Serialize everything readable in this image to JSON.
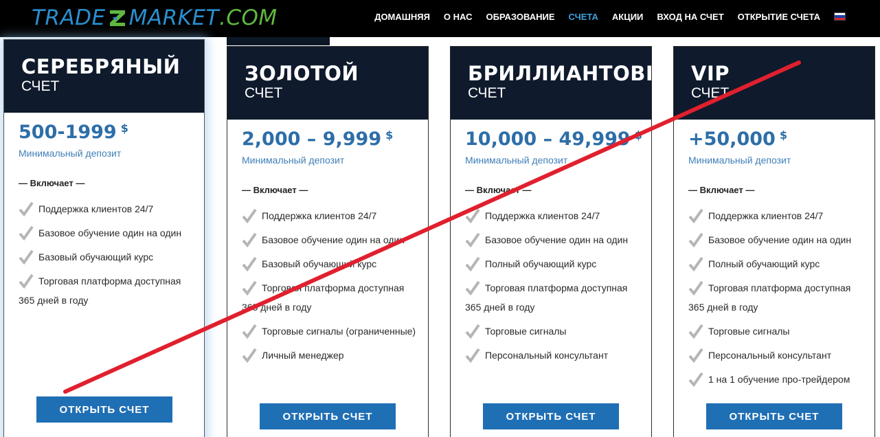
{
  "header": {
    "logo": {
      "part1": "TRADE",
      "part2": "MARKET",
      "part3": ".COM"
    },
    "nav": [
      {
        "label": "ДОМАШНЯЯ",
        "active": false
      },
      {
        "label": "О НАС",
        "active": false
      },
      {
        "label": "ОБРАЗОВАНИЕ",
        "active": false
      },
      {
        "label": "СЧЕТА",
        "active": true
      },
      {
        "label": "АКЦИИ",
        "active": false
      },
      {
        "label": "ВХОД НА СЧЕТ",
        "active": false
      },
      {
        "label": "ОТКРЫТИЕ СЧЕТА",
        "active": false
      }
    ],
    "language_flag": "russia-flag-icon"
  },
  "colors": {
    "header_bg": "#000000",
    "card_head_bg": "#0f1a2c",
    "price": "#2d6ea8",
    "button": "#1f6fb5",
    "active_nav": "#3fa0dc",
    "strike_line": "#e0202e"
  },
  "cards": [
    {
      "title": "СЕРЕБРЯНЫЙ",
      "subtitle": "СЧЕТ",
      "price": "500-1999",
      "currency": "$",
      "min_deposit_label": "Минимальный депозит",
      "includes_label": "— Включает —",
      "features": [
        "Поддержка клиентов 24/7",
        "Базовое обучение один на один",
        "Базовый обучающий курс",
        "Торговая платформа доступная",
        "365 дней в году"
      ],
      "button_label": "ОТКРЫТЬ СЧЕТ"
    },
    {
      "title": "ЗОЛОТОЙ",
      "subtitle": "СЧЕТ",
      "price": "2,000 – 9,999",
      "currency": "$",
      "min_deposit_label": "Минимальный депозит",
      "includes_label": "— Включает —",
      "features": [
        "Поддержка клиентов 24/7",
        "Базовое обучение один на один",
        "Базовый обучающий курс",
        "Торговая платформа доступная",
        "365 дней в году",
        "Торговые сигналы (ограниченные)",
        "Личный менеджер"
      ],
      "button_label": "ОТКРЫТЬ СЧЕТ"
    },
    {
      "title": "БРИЛЛИАНТОВЫЙ",
      "subtitle": "СЧЕТ",
      "price": "10,000 – 49,999",
      "currency": "$",
      "min_deposit_label": "Минимальный депозит",
      "includes_label": "— Включает —",
      "features": [
        "Поддержка клиентов 24/7",
        "Базовое обучение один на один",
        "Полный обучающий курс",
        "Торговая платформа доступная",
        "365 дней в году",
        "Торговые сигналы",
        "Персональный консультант"
      ],
      "button_label": "ОТКРЫТЬ СЧЕТ"
    },
    {
      "title": "VIP",
      "subtitle": "СЧЕТ",
      "price": "+50,000",
      "currency": "$",
      "min_deposit_label": "Минимальный депозит",
      "includes_label": "— Включает —",
      "features": [
        "Поддержка клиентов 24/7",
        "Базовое обучение один на один",
        "Полный обучающий курс",
        "Торговая платформа доступная",
        "365 дней в году",
        "Торговые сигналы",
        "Персональный консультант",
        "1 на 1 обучение про-трейдером"
      ],
      "button_label": "ОТКРЫТЬ СЧЕТ"
    }
  ]
}
